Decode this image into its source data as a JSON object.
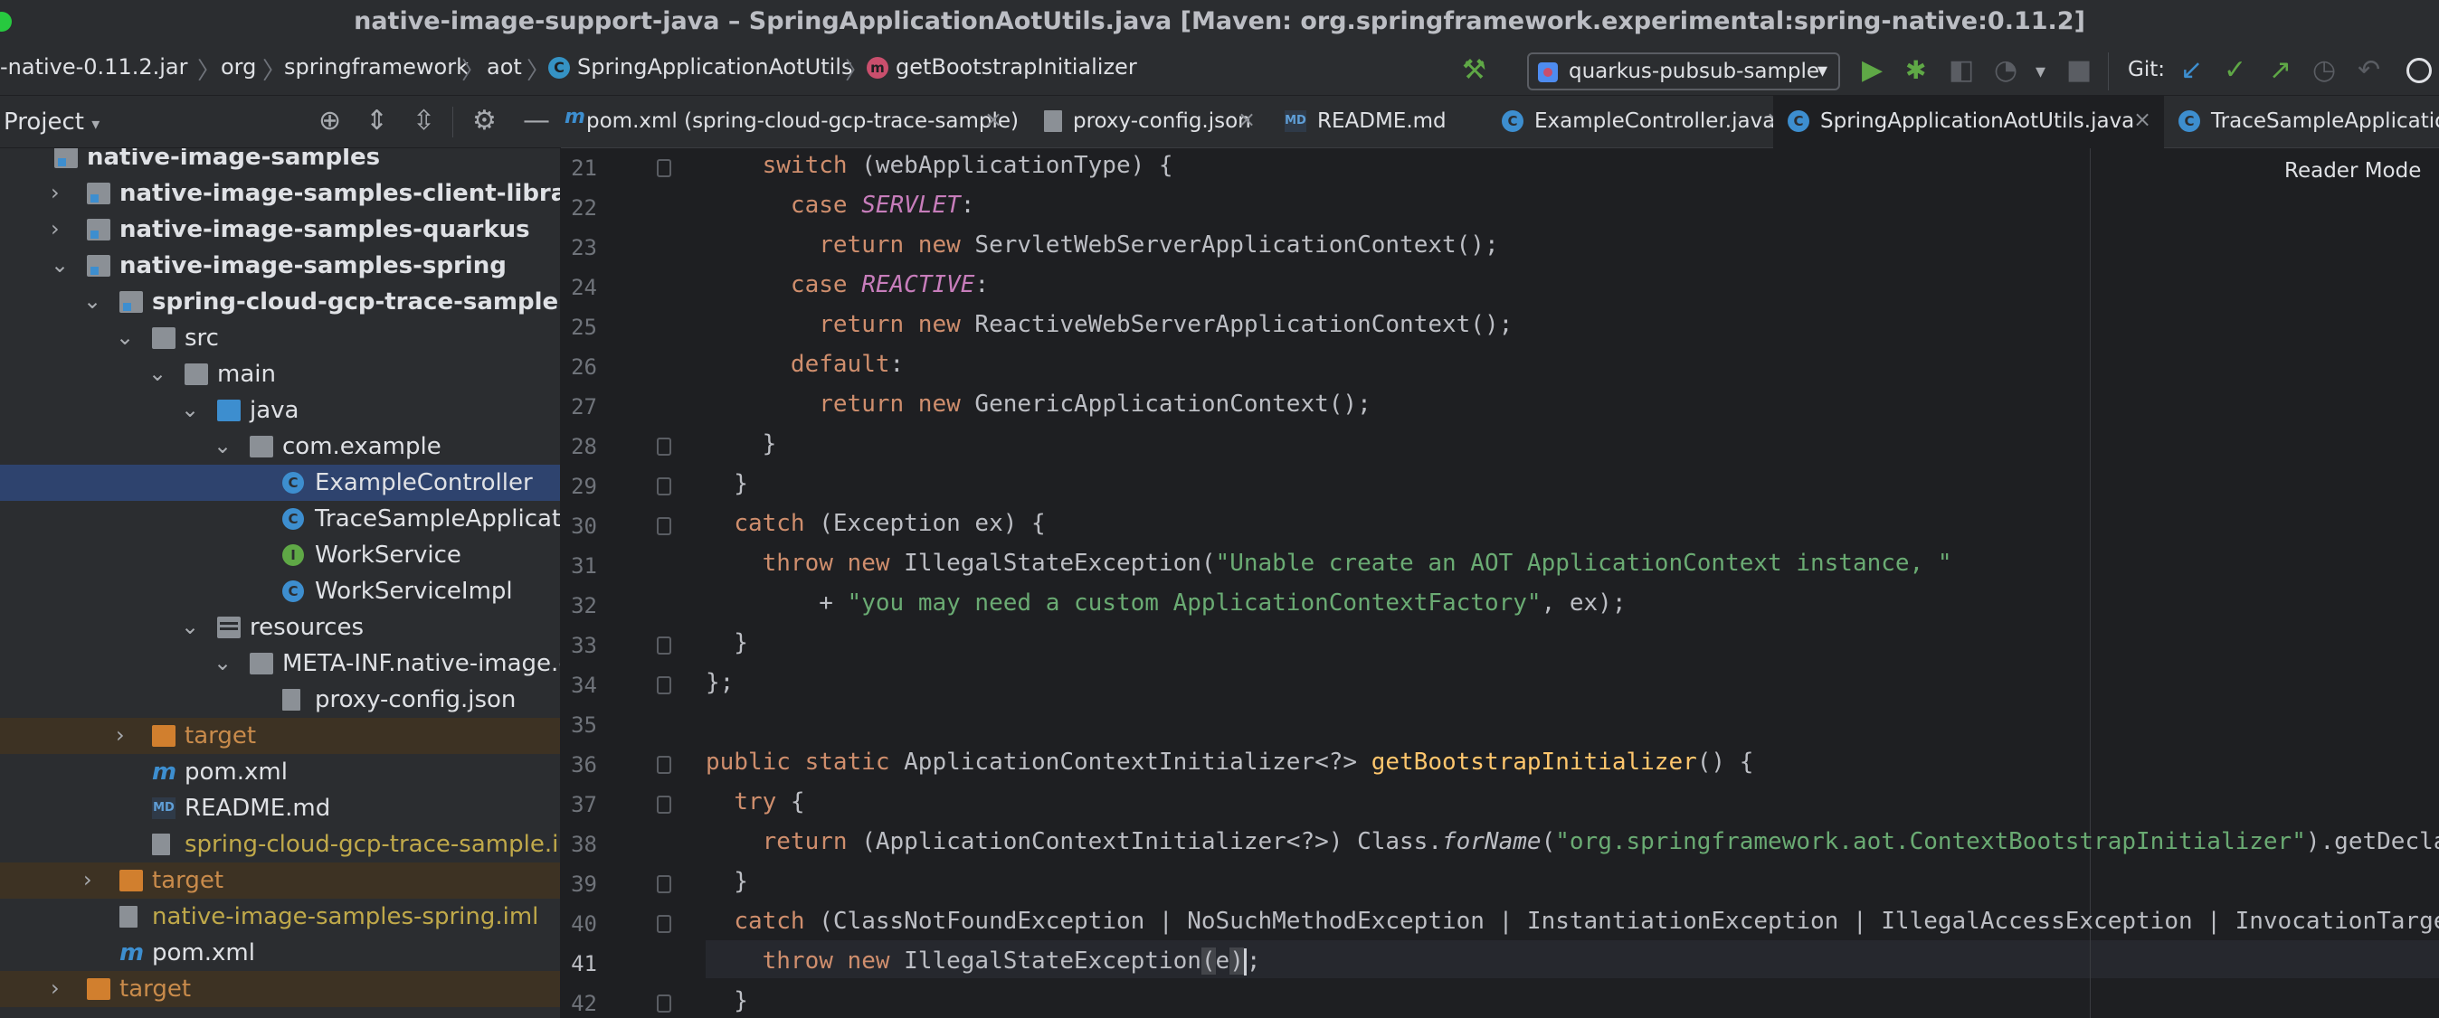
{
  "window": {
    "title": "native-image-support-java – SpringApplicationAotUtils.java [Maven: org.springframework.experimental:spring-native:0.11.2]"
  },
  "breadcrumb": [
    {
      "label": "-native-0.11.2.jar"
    },
    {
      "label": "org"
    },
    {
      "label": "springframework"
    },
    {
      "label": "aot"
    },
    {
      "label": "SpringApplicationAotUtils",
      "icon": "class-icon"
    },
    {
      "label": "getBootstrapInitializer",
      "icon": "method-icon"
    }
  ],
  "toolbar": {
    "run_config": "quarkus-pubsub-sample",
    "git_label": "Git:"
  },
  "project": {
    "title": "Project",
    "tree": [
      {
        "label": "native-image-samples",
        "depth": 0,
        "arrow": "",
        "icon": "module",
        "bold": true
      },
      {
        "label": "native-image-samples-client-library",
        "depth": 1,
        "arrow": "›",
        "icon": "module",
        "bold": true
      },
      {
        "label": "native-image-samples-quarkus",
        "depth": 1,
        "arrow": "›",
        "icon": "module",
        "bold": true
      },
      {
        "label": "native-image-samples-spring",
        "depth": 1,
        "arrow": "⌄",
        "icon": "module",
        "bold": true
      },
      {
        "label": "spring-cloud-gcp-trace-sample",
        "depth": 2,
        "arrow": "⌄",
        "icon": "module",
        "bold": true
      },
      {
        "label": "src",
        "depth": 3,
        "arrow": "⌄",
        "icon": "folder"
      },
      {
        "label": "main",
        "depth": 4,
        "arrow": "⌄",
        "icon": "folder"
      },
      {
        "label": "java",
        "depth": 5,
        "arrow": "⌄",
        "icon": "folder-blue"
      },
      {
        "label": "com.example",
        "depth": 6,
        "arrow": "⌄",
        "icon": "package"
      },
      {
        "label": "ExampleController",
        "depth": 7,
        "arrow": "",
        "icon": "class",
        "selected": true
      },
      {
        "label": "TraceSampleApplication",
        "depth": 7,
        "arrow": "",
        "icon": "class"
      },
      {
        "label": "WorkService",
        "depth": 7,
        "arrow": "",
        "icon": "interface"
      },
      {
        "label": "WorkServiceImpl",
        "depth": 7,
        "arrow": "",
        "icon": "class"
      },
      {
        "label": "resources",
        "depth": 5,
        "arrow": "⌄",
        "icon": "resources"
      },
      {
        "label": "META-INF.native-image.co",
        "depth": 6,
        "arrow": "⌄",
        "icon": "folder"
      },
      {
        "label": "proxy-config.json",
        "depth": 7,
        "arrow": "",
        "icon": "file"
      },
      {
        "label": "target",
        "depth": 3,
        "arrow": "›",
        "icon": "folder-orange",
        "excluded": true
      },
      {
        "label": "pom.xml",
        "depth": 3,
        "arrow": "",
        "icon": "pom"
      },
      {
        "label": "README.md",
        "depth": 3,
        "arrow": "",
        "icon": "md"
      },
      {
        "label": "spring-cloud-gcp-trace-sample.iml",
        "depth": 3,
        "arrow": "",
        "icon": "file",
        "color": "yellow"
      },
      {
        "label": "target",
        "depth": 2,
        "arrow": "›",
        "icon": "folder-orange",
        "excluded": true
      },
      {
        "label": "native-image-samples-spring.iml",
        "depth": 2,
        "arrow": "",
        "icon": "file",
        "color": "yellow"
      },
      {
        "label": "pom.xml",
        "depth": 2,
        "arrow": "",
        "icon": "pom"
      },
      {
        "label": "target",
        "depth": 1,
        "arrow": "›",
        "icon": "folder-orange",
        "excluded": true
      }
    ]
  },
  "tabs": [
    {
      "label": "pom.xml (spring-cloud-gcp-trace-sample)",
      "icon": "pom"
    },
    {
      "label": "proxy-config.json",
      "icon": "file"
    },
    {
      "label": "README.md",
      "icon": "md"
    },
    {
      "label": "ExampleController.java",
      "icon": "class"
    },
    {
      "label": "SpringApplicationAotUtils.java",
      "icon": "class",
      "active": true
    },
    {
      "label": "TraceSampleApplication",
      "icon": "class"
    }
  ],
  "editor": {
    "reader_mode": "Reader Mode",
    "current_line": 41,
    "lines": [
      {
        "n": 21,
        "fold": true,
        "html": "    <span class=\"kw\">switch</span> (webApplicationType) {"
      },
      {
        "n": 22,
        "html": "      <span class=\"kw\">case</span> <span class=\"en\">SERVLET</span>:"
      },
      {
        "n": 23,
        "html": "        <span class=\"kw\">return new</span> ServletWebServerApplicationContext();"
      },
      {
        "n": 24,
        "html": "      <span class=\"kw\">case</span> <span class=\"en\">REACTIVE</span>:"
      },
      {
        "n": 25,
        "html": "        <span class=\"kw\">return new</span> ReactiveWebServerApplicationContext();"
      },
      {
        "n": 26,
        "html": "      <span class=\"kw\">default</span>:"
      },
      {
        "n": 27,
        "html": "        <span class=\"kw\">return new</span> GenericApplicationContext();"
      },
      {
        "n": 28,
        "fold": true,
        "html": "    }"
      },
      {
        "n": 29,
        "fold": true,
        "html": "  }"
      },
      {
        "n": 30,
        "fold": true,
        "html": "  <span class=\"kw\">catch</span> (Exception ex) {"
      },
      {
        "n": 31,
        "html": "    <span class=\"kw\">throw new</span> IllegalStateException(<span class=\"str\">\"Unable create an AOT ApplicationContext instance, \"</span>"
      },
      {
        "n": 32,
        "html": "        + <span class=\"str\">\"you may need a custom ApplicationContextFactory\"</span>, ex);"
      },
      {
        "n": 33,
        "fold": true,
        "html": "  }"
      },
      {
        "n": 34,
        "fold": true,
        "html": "};"
      },
      {
        "n": 35,
        "html": ""
      },
      {
        "n": 36,
        "fold": true,
        "html": "<span class=\"kw\">public static</span> ApplicationContextInitializer&lt;?&gt; <span class=\"mtd\">getBootstrapInitializer</span>() {"
      },
      {
        "n": 37,
        "fold": true,
        "html": "  <span class=\"kw\">try</span> {"
      },
      {
        "n": 38,
        "html": "    <span class=\"kw\">return</span> (ApplicationContextInitializer&lt;?&gt;) Class.<span class=\"it\">forName</span>(<span class=\"str\">\"org.springframework.aot.ContextBootstrapInitializer\"</span>).getDecla"
      },
      {
        "n": 39,
        "fold": true,
        "html": "  }"
      },
      {
        "n": 40,
        "fold": true,
        "html": "  <span class=\"kw\">catch</span> (ClassNotFoundException | NoSuchMethodException | InstantiationException | IllegalAccessException | InvocationTarge"
      },
      {
        "n": 41,
        "html": "    <span class=\"kw\">throw new</span> IllegalStateException<span class=\"hl\">(</span>e<span class=\"hl\">)</span><span class=\"caret\"></span>;"
      },
      {
        "n": 42,
        "fold": true,
        "html": "  }"
      }
    ]
  }
}
